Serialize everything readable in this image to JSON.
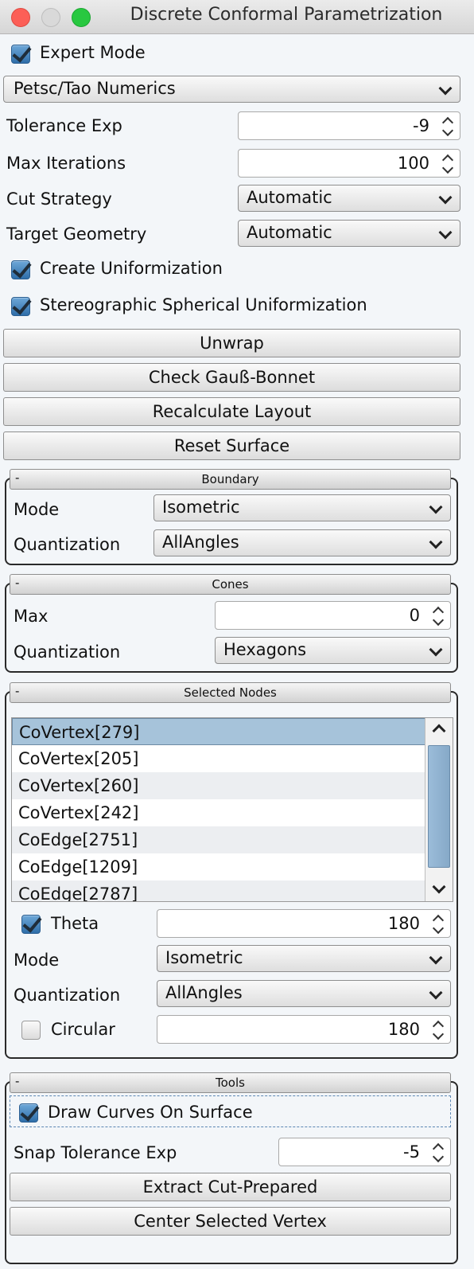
{
  "window": {
    "title": "Discrete Conformal Parametrization"
  },
  "expert_mode": {
    "label": "Expert Mode",
    "checked": true
  },
  "numerics": {
    "selected": "Petsc/Tao Numerics"
  },
  "tolerance_exp": {
    "label": "Tolerance Exp",
    "value": "-9"
  },
  "max_iterations": {
    "label": "Max Iterations",
    "value": "100"
  },
  "cut_strategy": {
    "label": "Cut Strategy",
    "selected": "Automatic"
  },
  "target_geometry": {
    "label": "Target Geometry",
    "selected": "Automatic"
  },
  "create_uniformization": {
    "label": "Create Uniformization",
    "checked": true
  },
  "stereographic": {
    "label": "Stereographic Spherical Uniformization",
    "checked": true
  },
  "buttons": {
    "unwrap": "Unwrap",
    "check_gauss_bonnet": "Check Gauß-Bonnet",
    "recalculate_layout": "Recalculate Layout",
    "reset_surface": "Reset Surface"
  },
  "boundary": {
    "collapse": "-",
    "title": "Boundary",
    "mode_label": "Mode",
    "mode_selected": "Isometric",
    "quantization_label": "Quantization",
    "quantization_selected": "AllAngles"
  },
  "cones": {
    "collapse": "-",
    "title": "Cones",
    "max_label": "Max",
    "max_value": "0",
    "quantization_label": "Quantization",
    "quantization_selected": "Hexagons"
  },
  "selected_nodes": {
    "collapse": "-",
    "title": "Selected Nodes",
    "items": [
      "CoVertex[279]",
      "CoVertex[205]",
      "CoVertex[260]",
      "CoVertex[242]",
      "CoEdge[2751]",
      "CoEdge[1209]",
      "CoEdge[2787]"
    ],
    "selected_index": 0,
    "theta_label": "Theta",
    "theta_checked": true,
    "theta_value": "180",
    "mode_label": "Mode",
    "mode_selected": "Isometric",
    "quantization_label": "Quantization",
    "quantization_selected": "AllAngles",
    "circular_label": "Circular",
    "circular_checked": false,
    "circular_value": "180"
  },
  "tools": {
    "collapse": "-",
    "title": "Tools",
    "draw_curves_label": "Draw Curves On Surface",
    "draw_curves_checked": true,
    "snap_label": "Snap Tolerance Exp",
    "snap_value": "-5",
    "extract_button": "Extract Cut-Prepared",
    "center_button": "Center Selected Vertex"
  },
  "colors": {
    "accent": "#2f6ea9",
    "selection": "#a6c3da",
    "close": "#fc5f57",
    "maximize": "#28c840"
  }
}
